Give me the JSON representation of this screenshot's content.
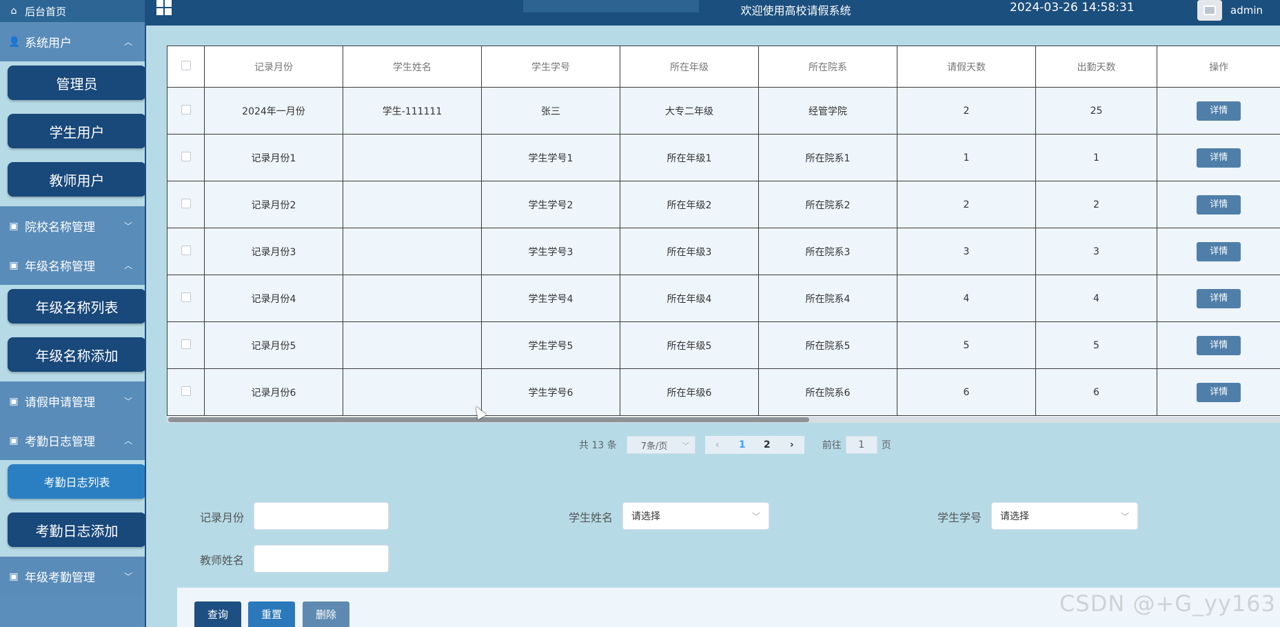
{
  "sidebar": {
    "home": "后台首页",
    "groups": [
      {
        "label": "系统用户",
        "expanded": true,
        "items": [
          "管理员",
          "学生用户",
          "教师用户"
        ]
      },
      {
        "label": "院校名称管理",
        "expanded": false,
        "items": []
      },
      {
        "label": "年级名称管理",
        "expanded": true,
        "items": [
          "年级名称列表",
          "年级名称添加"
        ]
      },
      {
        "label": "请假申请管理",
        "expanded": false,
        "items": []
      },
      {
        "label": "考勤日志管理",
        "expanded": true,
        "items": [
          "考勤日志列表",
          "考勤日志添加"
        ]
      },
      {
        "label": "年级考勤管理",
        "expanded": false,
        "items": []
      }
    ]
  },
  "topbar": {
    "title": "欢迎使用高校请假系统",
    "datetime": "2024-03-26 14:58:31",
    "user": "admin"
  },
  "table": {
    "headers": [
      "记录月份",
      "学生姓名",
      "学生学号",
      "所在年级",
      "所在院系",
      "请假天数",
      "出勤天数",
      "操作"
    ],
    "detail_label": "详情",
    "rows": [
      [
        "2024年一月份",
        "学生-111111",
        "张三",
        "大专二年级",
        "经管学院",
        "2",
        "25"
      ],
      [
        "记录月份1",
        "",
        "学生学号1",
        "所在年级1",
        "所在院系1",
        "1",
        "1"
      ],
      [
        "记录月份2",
        "",
        "学生学号2",
        "所在年级2",
        "所在院系2",
        "2",
        "2"
      ],
      [
        "记录月份3",
        "",
        "学生学号3",
        "所在年级3",
        "所在院系3",
        "3",
        "3"
      ],
      [
        "记录月份4",
        "",
        "学生学号4",
        "所在年级4",
        "所在院系4",
        "4",
        "4"
      ],
      [
        "记录月份5",
        "",
        "学生学号5",
        "所在年级5",
        "所在院系5",
        "5",
        "5"
      ],
      [
        "记录月份6",
        "",
        "学生学号6",
        "所在年级6",
        "所在院系6",
        "6",
        "6"
      ]
    ]
  },
  "pagination": {
    "total": "共 13 条",
    "page_size": "7条/页",
    "pages": [
      "1",
      "2"
    ],
    "current_page": "1",
    "goto_prefix": "前往",
    "goto_value": "1",
    "goto_suffix": "页"
  },
  "search": {
    "record_month_label": "记录月份",
    "record_month_value": "",
    "student_name_label": "学生姓名",
    "student_name_value": "请选择",
    "student_no_label": "学生学号",
    "student_no_value": "请选择",
    "teacher_name_label": "教师姓名",
    "teacher_name_value": ""
  },
  "actions": {
    "query": "查询",
    "reset": "重置",
    "delete": "删除"
  },
  "watermark": "CSDN @+G_yy163"
}
